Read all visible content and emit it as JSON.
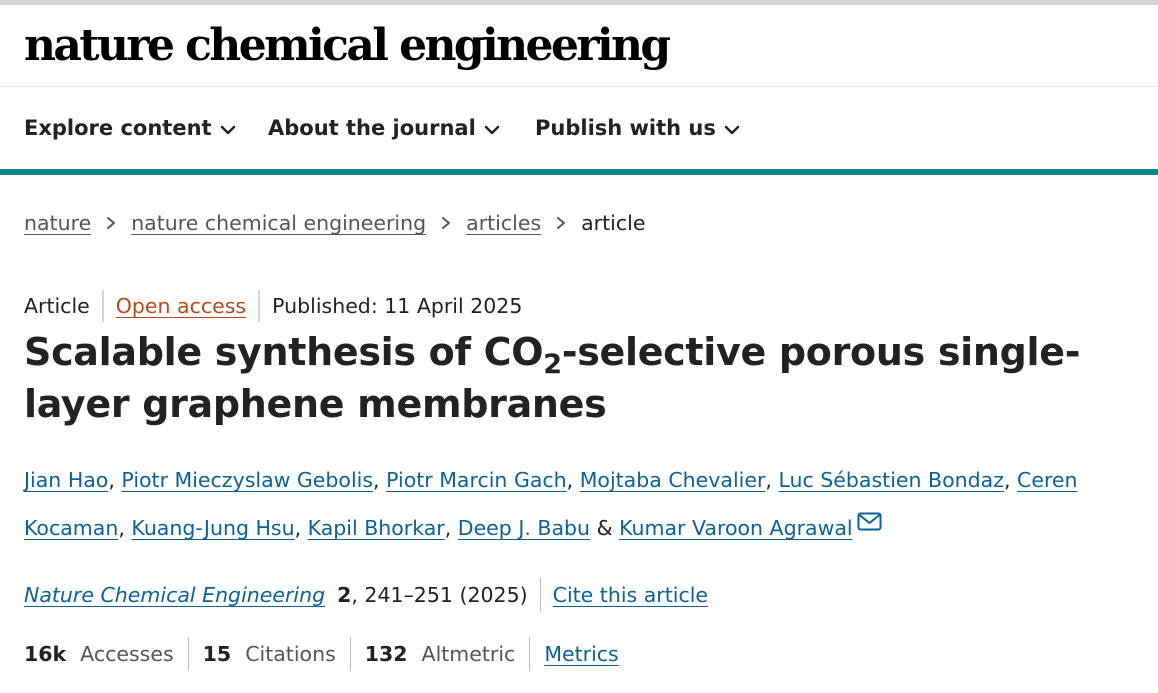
{
  "brand": {
    "name": "nature chemical engineering"
  },
  "nav": {
    "items": [
      {
        "label": "Explore content"
      },
      {
        "label": "About the journal"
      },
      {
        "label": "Publish with us"
      }
    ]
  },
  "breadcrumb": {
    "items": [
      {
        "label": "nature"
      },
      {
        "label": "nature chemical engineering"
      },
      {
        "label": "articles"
      }
    ],
    "current": "article"
  },
  "article": {
    "type": "Article",
    "access": "Open access",
    "published": "Published: 11 April 2025",
    "title_part1": "Scalable synthesis of CO",
    "title_subscript": "2",
    "title_part2": "-selective porous single-layer graphene membranes",
    "authors": [
      "Jian Hao",
      "Piotr Mieczyslaw Gebolis",
      "Piotr Marcin Gach",
      "Mojtaba Chevalier",
      "Luc Sébastien Bondaz",
      "Ceren Kocaman",
      "Kuang-Jung Hsu",
      "Kapil Bhorkar",
      "Deep J. Babu",
      "Kumar Varoon Agrawal"
    ],
    "author_separator": ",",
    "author_last_separator": "&"
  },
  "citation": {
    "journal": "Nature Chemical Engineering",
    "volume": "2",
    "pages_year": ", 241–251 (2025)",
    "cite_label": "Cite this article"
  },
  "metrics": {
    "accesses_value": "16k",
    "accesses_label": "Accesses",
    "citations_value": "15",
    "citations_label": "Citations",
    "altmetric_value": "132",
    "altmetric_label": "Altmetric",
    "metrics_link": "Metrics"
  },
  "colors": {
    "teal_accent": "#0a8a87",
    "link_blue": "#0c6296",
    "open_access_orange": "#b64b1a"
  },
  "icons": {
    "nav_chevron": "chevron-down-icon",
    "breadcrumb_separator": "chevron-right-icon",
    "corresponding_author": "envelope-icon"
  }
}
